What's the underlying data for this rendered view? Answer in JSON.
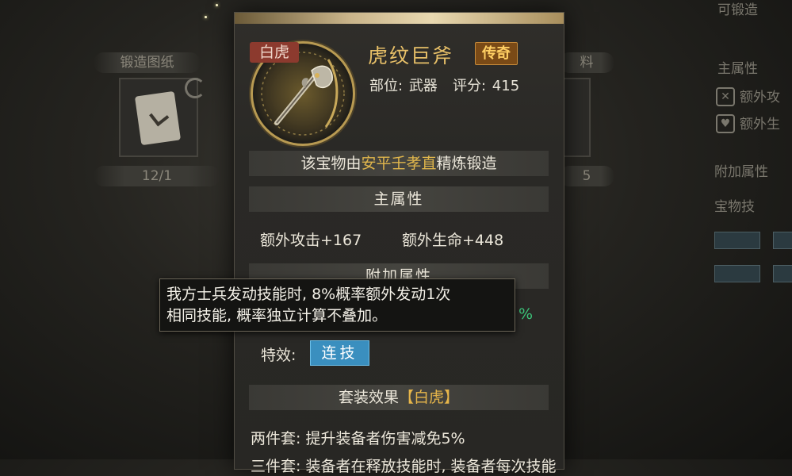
{
  "background": {
    "left_tab_1": "锻造图纸",
    "left_tab_2": "12/1",
    "right_tab_1": "料",
    "right_tab_2": "5",
    "right_header": "主属性",
    "right_item_1": "额外攻",
    "right_item_2": "额外生",
    "right_section_1": "附加属性",
    "right_section_2": "宝物技",
    "top_right_fragment": "可锻造"
  },
  "tooltip": {
    "faction_badge": "白虎",
    "item_name": "虎纹巨斧",
    "rarity": "传奇",
    "slot_label": "部位:",
    "slot_value": "武器",
    "score_label": "评分:",
    "score_value": "415",
    "forge_prefix": "该宝物由",
    "forge_name": "安平壬孝直",
    "forge_suffix": "精炼锻造",
    "main_attr_header": "主属性",
    "stats": [
      "额外攻击+167",
      "额外生命+448"
    ],
    "extra_attr_header": "附加属性",
    "extra_attr_value_peek": "%",
    "effect_label": "特效:",
    "effect_chip": "连技",
    "set_header_prefix": "套装效果",
    "set_header_bracket_open": "【",
    "set_header_name": "白虎",
    "set_header_bracket_close": "】",
    "set_two_piece": "两件套: 提升装备者伤害减免5%",
    "set_three_piece": "三件套: 装备者在释放技能时, 装备者每次技能"
  },
  "float_tip": {
    "line1": "我方士兵发动技能时, 8%概率额外发动1次",
    "line2": "相同技能, 概率独立计算不叠加。"
  },
  "colors": {
    "name_gold": "#e8c068",
    "rarity_bg": "#7a4a16",
    "faction_red": "#8c3a2e",
    "highlight_gold": "#e0b64c",
    "effect_blue": "#3a8fbf",
    "percent_green": "#3cc47a"
  },
  "icons": {
    "item": "battle-axe-icon",
    "refresh": "refresh-icon"
  }
}
